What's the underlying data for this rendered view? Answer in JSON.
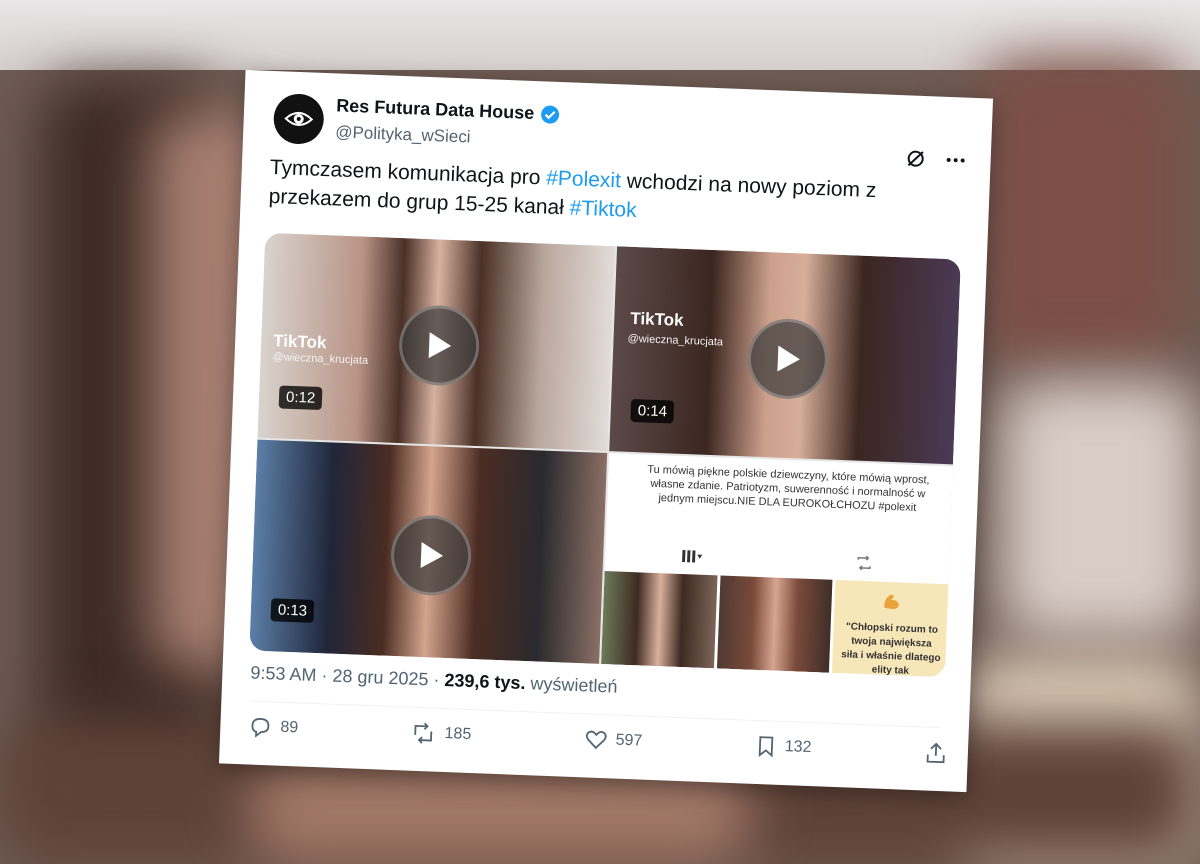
{
  "tweet": {
    "author_name": "Res Futura Data House",
    "handle": "@Polityka_wSieci",
    "text_parts": [
      "Tymczasem komunikacja pro ",
      "#Polexit",
      " wchodzi na nowy poziom z przekazem do grup 15-25 kanał ",
      "#Tiktok"
    ],
    "time": "9:53 AM",
    "date": "28 gru 2025",
    "views_count": "239,6 tys.",
    "views_label": "wyświetleń"
  },
  "media": {
    "videos": [
      {
        "duration": "0:12",
        "brand": "TikTok",
        "tiktok_handle": "@wieczna_krucjata"
      },
      {
        "duration": "0:14",
        "brand": "TikTok",
        "tiktok_handle": "@wieczna_krucjata"
      },
      {
        "duration": "0:13"
      }
    ],
    "tiktok_profile": {
      "bio": "Tu mówią piękne polskie dziewczyny, które mówią wprost, własne zdanie. Patriotyzm, suwerenność i normalność w jednym miejscu.NIE DLA EUROKOŁCHOZU #polexit",
      "quote": "\"Chłopski rozum to twoja największa siła i właśnie dlatego elity tak"
    }
  },
  "actions": {
    "replies": "89",
    "reposts": "185",
    "likes": "597",
    "bookmarks": "132"
  },
  "colors": {
    "link": "#1d9bf0",
    "verified": "#1d9bf0",
    "muted": "#536471",
    "text": "#0f1419"
  }
}
